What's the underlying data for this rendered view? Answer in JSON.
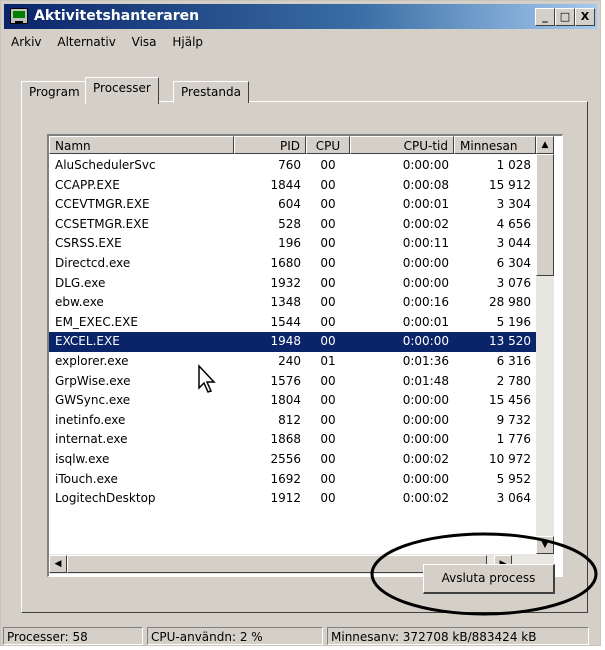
{
  "window": {
    "title": "Aktivitetshanteraren"
  },
  "titlebar_buttons": {
    "minimize": "_",
    "maximize": "□",
    "close": "X"
  },
  "menu": [
    "Arkiv",
    "Alternativ",
    "Visa",
    "Hjälp"
  ],
  "tabs": [
    {
      "label": "Program",
      "active": false
    },
    {
      "label": "Processer",
      "active": true
    },
    {
      "label": "Prestanda",
      "active": false
    }
  ],
  "table": {
    "columns": [
      "Namn",
      "PID",
      "CPU",
      "CPU-tid",
      "Minnesan"
    ],
    "rows": [
      [
        "AluSchedulerSvc",
        "760",
        "00",
        "0:00:00",
        "1 028"
      ],
      [
        "CCAPP.EXE",
        "1844",
        "00",
        "0:00:08",
        "15 912"
      ],
      [
        "CCEVTMGR.EXE",
        "604",
        "00",
        "0:00:01",
        "3 304"
      ],
      [
        "CCSETMGR.EXE",
        "528",
        "00",
        "0:00:02",
        "4 656"
      ],
      [
        "CSRSS.EXE",
        "196",
        "00",
        "0:00:11",
        "3 044"
      ],
      [
        "Directcd.exe",
        "1680",
        "00",
        "0:00:00",
        "6 304"
      ],
      [
        "DLG.exe",
        "1932",
        "00",
        "0:00:00",
        "3 076"
      ],
      [
        "ebw.exe",
        "1348",
        "00",
        "0:00:16",
        "28 980"
      ],
      [
        "EM_EXEC.EXE",
        "1544",
        "00",
        "0:00:01",
        "5 196"
      ],
      [
        "EXCEL.EXE",
        "1948",
        "00",
        "0:00:00",
        "13 520"
      ],
      [
        "explorer.exe",
        "240",
        "01",
        "0:01:36",
        "6 316"
      ],
      [
        "GrpWise.exe",
        "1576",
        "00",
        "0:01:48",
        "2 780"
      ],
      [
        "GWSync.exe",
        "1804",
        "00",
        "0:00:00",
        "15 456"
      ],
      [
        "inetinfo.exe",
        "812",
        "00",
        "0:00:00",
        "9 732"
      ],
      [
        "internat.exe",
        "1868",
        "00",
        "0:00:00",
        "1 776"
      ],
      [
        "isqlw.exe",
        "2556",
        "00",
        "0:00:02",
        "10 972"
      ],
      [
        "iTouch.exe",
        "1692",
        "00",
        "0:00:00",
        "5 952"
      ],
      [
        "LogitechDesktop",
        "1912",
        "00",
        "0:00:02",
        "3 064"
      ]
    ],
    "selected_row": "EXCEL.EXE"
  },
  "end_process_button": "Avsluta process",
  "status": {
    "processes": "Processer: 58",
    "cpu": "CPU-användn: 2 %",
    "memory": "Minnesanv: 372708 kB/883424 kB"
  },
  "colors": {
    "titlebar": "#0a246a",
    "selection": "#0a246a",
    "face": "#d4d0c8"
  }
}
